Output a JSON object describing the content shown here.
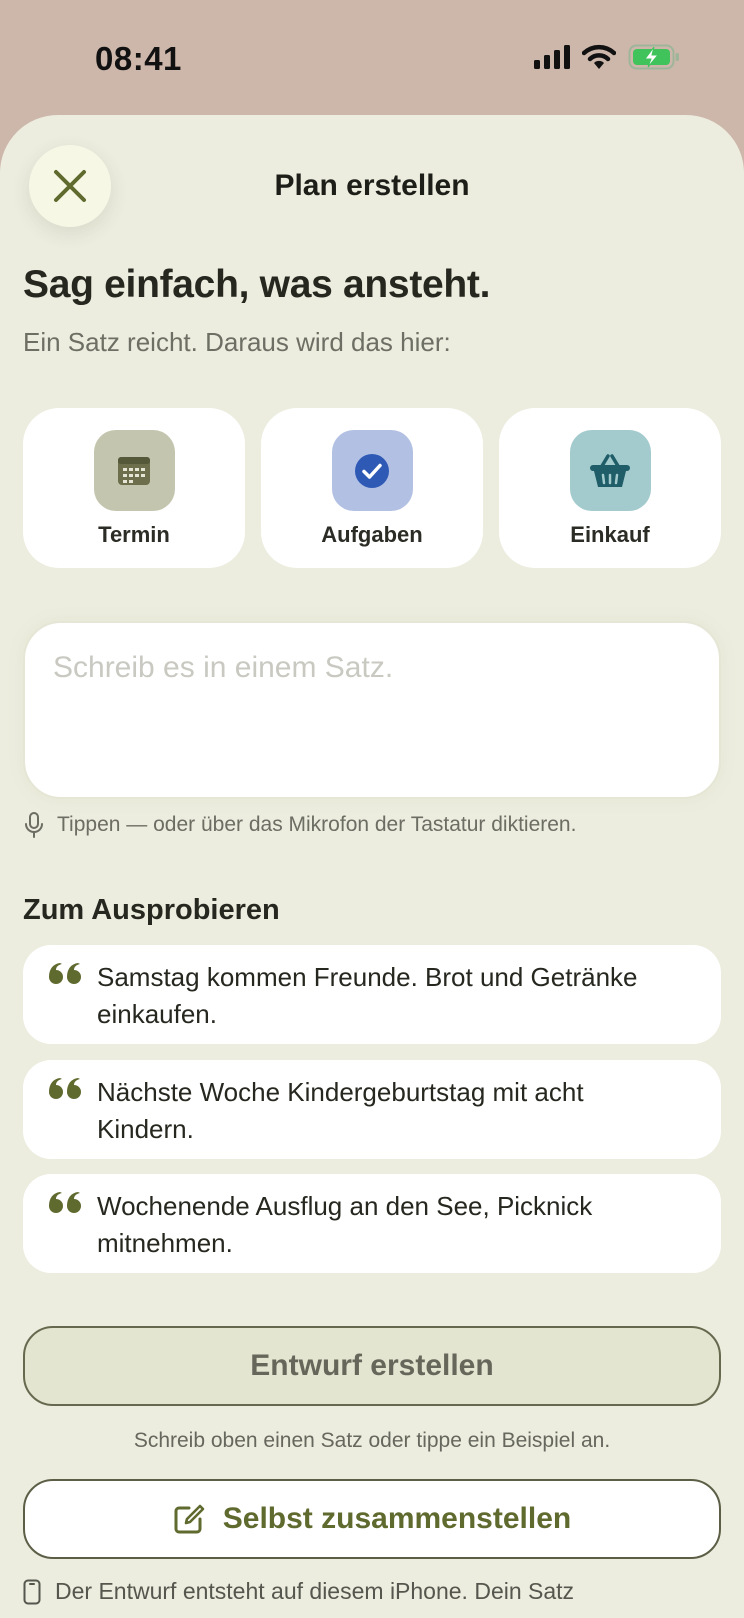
{
  "status_bar": {
    "time": "08:41"
  },
  "header": {
    "title": "Plan erstellen"
  },
  "intro": {
    "headline": "Sag einfach, was ansteht.",
    "subline": "Ein Satz reicht. Daraus wird das hier:"
  },
  "chips": [
    {
      "label": "Termin",
      "icon": "calendar-icon",
      "color": "#c4c5ae"
    },
    {
      "label": "Aufgaben",
      "icon": "checkmark-circle-icon",
      "color": "#b2c0e3"
    },
    {
      "label": "Einkauf",
      "icon": "basket-icon",
      "color": "#a3cbce"
    }
  ],
  "input": {
    "placeholder": "Schreib es in einem Satz.",
    "hint": "Tippen — oder über das Mikrofon der Tastatur diktieren."
  },
  "examples": {
    "title": "Zum Ausprobieren",
    "items": [
      {
        "line1": "Samstag kommen Freunde. Brot und Getränke",
        "line2": "einkaufen."
      },
      {
        "line1": "Nächste Woche Kindergeburtstag mit acht",
        "line2": "Kindern."
      },
      {
        "line1": "Wochenende Ausflug an den See, Picknick",
        "line2": "mitnehmen."
      }
    ]
  },
  "actions": {
    "primary_label": "Entwurf erstellen",
    "primary_hint": "Schreib oben einen Satz oder tippe ein Beispiel an.",
    "secondary_label": "Selbst zusammenstellen"
  },
  "footer": {
    "note": "Der Entwurf entsteht auf diesem iPhone. Dein Satz"
  },
  "colors": {
    "accent": "#5f6a2e",
    "sheet_background": "#ececdf",
    "backdrop": "#cdb7aa"
  }
}
